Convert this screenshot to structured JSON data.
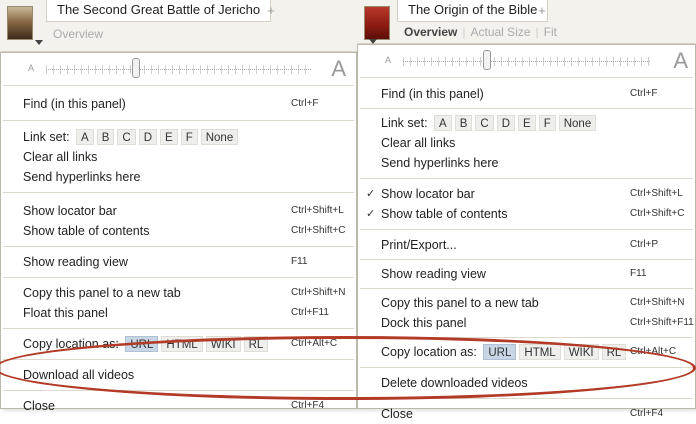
{
  "panel1": {
    "book_title": "The Second Great Battle of Jericho",
    "new_tab_glyph": "+",
    "subtabs": [
      "Overview"
    ],
    "zoom_small": "A",
    "zoom_big": "A",
    "items": {
      "find": "Find (in this panel)",
      "find_shortcut": "Ctrl+F",
      "link_set_label": "Link set:",
      "link_set_options": [
        "A",
        "B",
        "C",
        "D",
        "E",
        "F",
        "None"
      ],
      "clear_links": "Clear all links",
      "send_hyperlinks": "Send hyperlinks here",
      "show_locator": "Show locator bar",
      "show_locator_shortcut": "Ctrl+Shift+L",
      "show_toc": "Show table of contents",
      "show_toc_shortcut": "Ctrl+Shift+C",
      "show_reading": "Show reading view",
      "show_reading_shortcut": "F11",
      "copy_panel": "Copy this panel to a new tab",
      "copy_panel_shortcut": "Ctrl+Shift+N",
      "float_panel": "Float this panel",
      "float_panel_shortcut": "Ctrl+F11",
      "copy_location": "Copy location as:",
      "copy_location_options": [
        "URL",
        "HTML",
        "WIKI",
        "RL"
      ],
      "copy_location_shortcut": "Ctrl+Alt+C",
      "download_videos": "Download all videos",
      "close": "Close",
      "close_shortcut": "Ctrl+F4"
    }
  },
  "panel2": {
    "book_title": "The Origin of the Bible",
    "new_tab_glyph": "+",
    "subtabs": [
      "Overview",
      "Actual Size",
      "Fit"
    ],
    "zoom_small": "A",
    "zoom_big": "A",
    "items": {
      "find": "Find (in this panel)",
      "find_shortcut": "Ctrl+F",
      "link_set_label": "Link set:",
      "link_set_options": [
        "A",
        "B",
        "C",
        "D",
        "E",
        "F",
        "None"
      ],
      "clear_links": "Clear all links",
      "send_hyperlinks": "Send hyperlinks here",
      "check_glyph": "✓",
      "show_locator": "Show locator bar",
      "show_locator_shortcut": "Ctrl+Shift+L",
      "show_toc": "Show table of contents",
      "show_toc_shortcut": "Ctrl+Shift+C",
      "print_export": "Print/Export...",
      "print_export_shortcut": "Ctrl+P",
      "show_reading": "Show reading view",
      "show_reading_shortcut": "F11",
      "copy_panel": "Copy this panel to a new tab",
      "copy_panel_shortcut": "Ctrl+Shift+N",
      "dock_panel": "Dock this panel",
      "dock_panel_shortcut": "Ctrl+Shift+F11",
      "copy_location": "Copy location as:",
      "copy_location_options": [
        "URL",
        "HTML",
        "WIKI",
        "RL"
      ],
      "copy_location_shortcut": "Ctrl+Alt+C",
      "delete_videos": "Delete downloaded videos",
      "close": "Close",
      "close_shortcut": "Ctrl+F4"
    }
  },
  "colors": {
    "highlight_oval": "#b23a26",
    "selected_pill": "#c9d6e6"
  }
}
